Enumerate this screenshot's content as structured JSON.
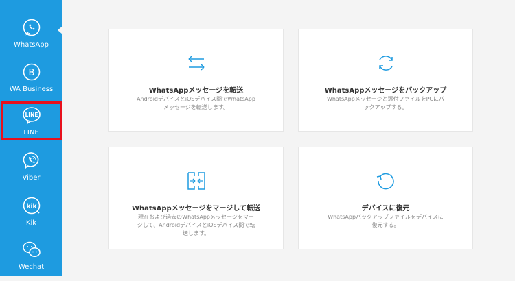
{
  "sidebar": {
    "items": [
      {
        "label": "WhatsApp",
        "icon": "whatsapp-icon"
      },
      {
        "label": "WA Business",
        "icon": "wa-business-icon"
      },
      {
        "label": "LINE",
        "icon": "line-icon"
      },
      {
        "label": "Viber",
        "icon": "viber-icon"
      },
      {
        "label": "Kik",
        "icon": "kik-icon"
      },
      {
        "label": "Wechat",
        "icon": "wechat-icon"
      }
    ]
  },
  "cards": [
    {
      "title": "WhatsAppメッセージを転送",
      "desc": "AndroidデバイスとiOSデバイス間でWhatsAppメッセージを転送します。",
      "icon": "transfer-arrows-icon"
    },
    {
      "title": "WhatsAppメッセージをバックアップ",
      "desc": "WhatsAppメッセージと添付ファイルをPCにバックアップする。",
      "icon": "backup-sync-icon"
    },
    {
      "title": "WhatsAppメッセージをマージして転送",
      "desc": "現在および過去のWhatsAppメッセージをマージして、AndroidデバイスとiOSデバイス間で転送します。",
      "icon": "merge-icon"
    },
    {
      "title": "デバイスに復元",
      "desc": "WhatsAppバックアップファイルをデバイスに復元する。",
      "icon": "restore-icon"
    }
  ],
  "colors": {
    "sidebar": "#1e9be0",
    "accent": "#1e9be0",
    "highlight": "#e8101c"
  }
}
